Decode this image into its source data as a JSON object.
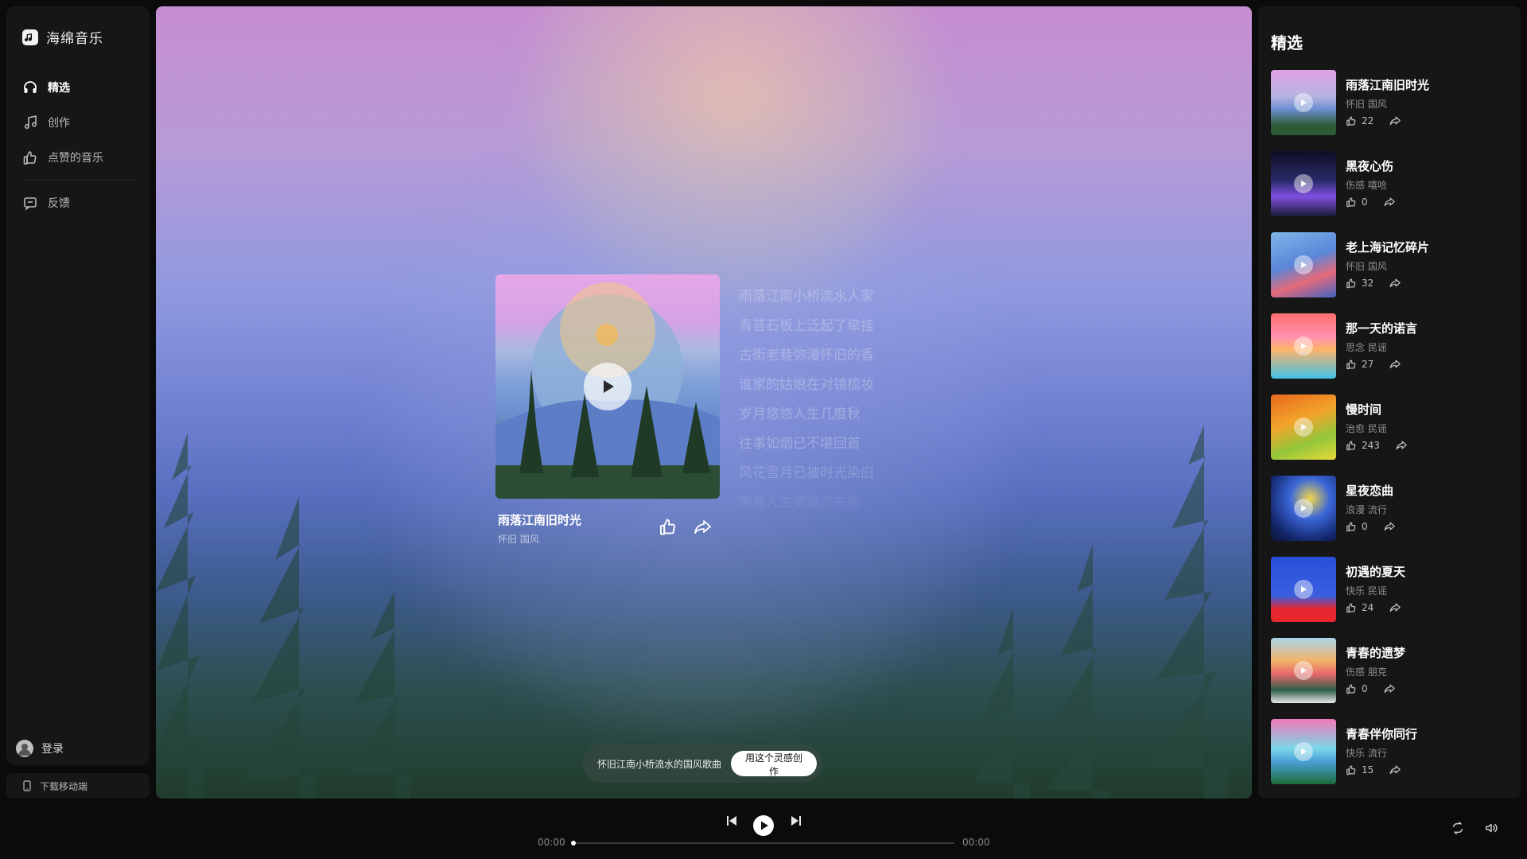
{
  "app": {
    "name": "海绵音乐"
  },
  "sidebar": {
    "items": [
      {
        "label": "精选",
        "icon": "headphones-icon",
        "active": true
      },
      {
        "label": "创作",
        "icon": "music-note-icon",
        "active": false
      },
      {
        "label": "点赞的音乐",
        "icon": "thumb-up-icon",
        "active": false
      }
    ],
    "feedback": {
      "label": "反馈",
      "icon": "feedback-icon"
    },
    "login": {
      "label": "登录"
    },
    "download": {
      "label": "下载移动端"
    }
  },
  "now_playing": {
    "title": "雨落江南旧时光",
    "tags": "怀旧 国风",
    "lyrics": [
      "雨落江南小桥流水人家",
      "青苔石板上泛起了牵挂",
      "古街老巷弥漫怀旧的香",
      "谁家的姑娘在对镜梳妆",
      "岁月悠悠人生几度秋",
      "往事如烟已不堪回首",
      "风花雪月已被时光染旧",
      "带着人生道路流失些"
    ]
  },
  "prompt": {
    "text": "怀旧江南小桥流水的国风歌曲",
    "button": "用这个灵感创作"
  },
  "featured": {
    "title": "精选",
    "items": [
      {
        "title": "雨落江南旧时光",
        "tags": "怀旧 国风",
        "likes": "22"
      },
      {
        "title": "黑夜心伤",
        "tags": "伤感 嘻哈",
        "likes": "0"
      },
      {
        "title": "老上海记忆碎片",
        "tags": "怀旧 国风",
        "likes": "32"
      },
      {
        "title": "那一天的诺言",
        "tags": "思念 民谣",
        "likes": "27"
      },
      {
        "title": "慢时间",
        "tags": "治愈 民谣",
        "likes": "243"
      },
      {
        "title": "星夜恋曲",
        "tags": "浪漫 流行",
        "likes": "0"
      },
      {
        "title": "初遇的夏天",
        "tags": "快乐 民谣",
        "likes": "24"
      },
      {
        "title": "青春的遗梦",
        "tags": "伤感 朋克",
        "likes": "0"
      },
      {
        "title": "青春伴你同行",
        "tags": "快乐 流行",
        "likes": "15"
      }
    ]
  },
  "player": {
    "current_time": "00:00",
    "total_time": "00:00",
    "progress": 0
  }
}
